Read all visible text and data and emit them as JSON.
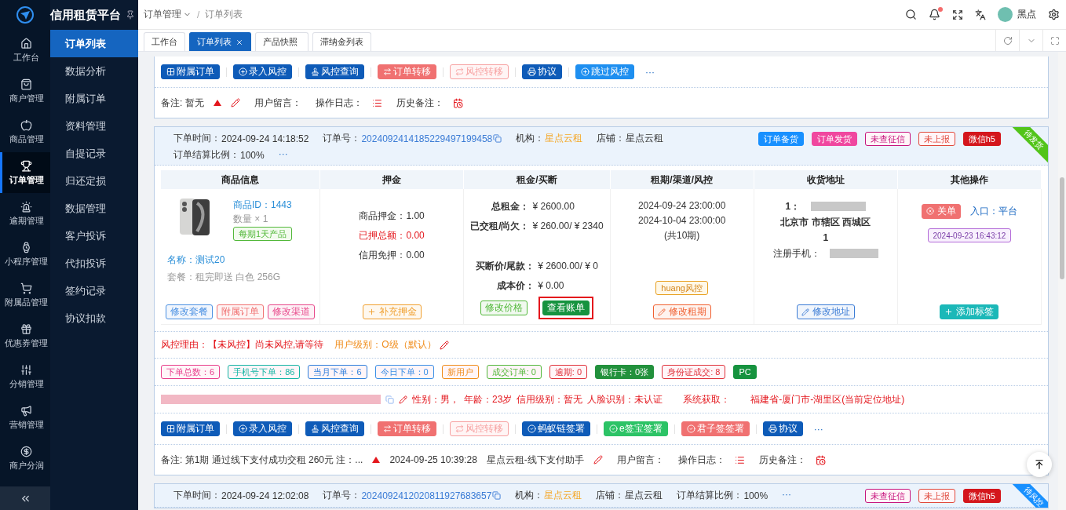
{
  "app": {
    "title": "信用租赁平台"
  },
  "rail": [
    {
      "label": "工作台",
      "selected": false
    },
    {
      "label": "商户管理",
      "selected": false
    },
    {
      "label": "商品管理",
      "selected": false
    },
    {
      "label": "订单管理",
      "selected": true
    },
    {
      "label": "逾期管理",
      "selected": false
    },
    {
      "label": "小程序管理",
      "selected": false
    },
    {
      "label": "附属品管理",
      "selected": false
    },
    {
      "label": "优惠券管理",
      "selected": false
    },
    {
      "label": "分销管理",
      "selected": false
    },
    {
      "label": "营销管理",
      "selected": false
    },
    {
      "label": "商户分润",
      "selected": false
    }
  ],
  "submenu": [
    {
      "label": "订单列表",
      "selected": true
    },
    {
      "label": "数据分析",
      "selected": false
    },
    {
      "label": "附属订单",
      "selected": false
    },
    {
      "label": "资料管理",
      "selected": false
    },
    {
      "label": "自提记录",
      "selected": false
    },
    {
      "label": "归还定损",
      "selected": false
    },
    {
      "label": "数据管理",
      "selected": false
    },
    {
      "label": "客户投诉",
      "selected": false
    },
    {
      "label": "代扣投诉",
      "selected": false
    },
    {
      "label": "签约记录",
      "selected": false
    },
    {
      "label": "协议扣款",
      "selected": false
    }
  ],
  "breadcrumb": {
    "items": [
      "订单管理",
      "订单列表"
    ],
    "separator": "/"
  },
  "header": {
    "user": "黑点",
    "unread": true
  },
  "tabs": [
    {
      "label": "工作台",
      "selected": false,
      "closable": false
    },
    {
      "label": "订单列表",
      "selected": true,
      "closable": true
    },
    {
      "label": "产品快照",
      "selected": false,
      "closable": false
    },
    {
      "label": "滞纳金列表",
      "selected": false,
      "closable": false
    }
  ],
  "orders": [
    {
      "actions": {
        "buttons": [
          {
            "label": "附属订单",
            "kind": "grid",
            "color": "#0e5bb8"
          },
          {
            "label": "录入风控",
            "kind": "plus",
            "color": "#0e5bb8"
          },
          {
            "label": "风控查询",
            "kind": "stamp",
            "color": "#0e5bb8"
          },
          {
            "label": "订单转移",
            "kind": "transfer",
            "color": "#f07171"
          },
          {
            "label": "风控转移",
            "kind": "repeat",
            "color": "#f7a1a1"
          },
          {
            "label": "协议",
            "kind": "print",
            "color": "#0e5bb8"
          },
          {
            "label": "跳过风控",
            "kind": "plus",
            "color": "#1e8ff0"
          }
        ],
        "more": "···"
      },
      "remark": {
        "text": "备注: 暂无",
        "labels": [
          "用户留言：",
          "操作日志：",
          "历史备注："
        ]
      }
    },
    {
      "header": {
        "fields": [
          {
            "label": "下单时间：",
            "value": "2024-09-24 14:18:52",
            "kind": "plain"
          },
          {
            "label": "订单号：",
            "value": "2024092414185229497199458",
            "kind": "link"
          },
          {
            "label": "机构：",
            "value": "星点云租",
            "kind": "accent"
          },
          {
            "label": "店铺：",
            "value": "星点云租",
            "kind": "plain"
          },
          {
            "label": "订单结算比例：",
            "value": "100%",
            "kind": "plain"
          }
        ],
        "more": "···",
        "tags": [
          {
            "label": "订单备货",
            "kind": "solid",
            "color": "#1890ff"
          },
          {
            "label": "订单发货",
            "kind": "solid",
            "color": "#f0479f"
          },
          {
            "label": "未查征信",
            "kind": "outline",
            "color": "#c7157e"
          },
          {
            "label": "未上报",
            "kind": "outline",
            "color": "#e0483c"
          },
          {
            "label": "微信h5",
            "kind": "solid",
            "color": "#d4161c"
          }
        ],
        "ribbon": {
          "label": "待发货",
          "color": "#52c41a"
        }
      },
      "table": {
        "columns": [
          "商品信息",
          "押金",
          "租金/买断",
          "租期/渠道/风控",
          "收货地址",
          "其他操作"
        ],
        "product": {
          "id": "商品ID：1443",
          "quantity": "数量 × 1",
          "tag": "每期1天产品",
          "name": "名称：测试20",
          "package": "套餐：租完即送 白色 256G",
          "buttons": [
            {
              "label": "修改套餐",
              "color": "#4a90e2"
            },
            {
              "label": "附属订单",
              "color": "#f07171"
            },
            {
              "label": "修改渠道",
              "color": "#e8488a"
            }
          ]
        },
        "deposit": {
          "lines": [
            {
              "label": "商品押金：",
              "value": "1.00",
              "alert": false
            },
            {
              "label": "已押总额：",
              "value": "0.00",
              "alert": true
            },
            {
              "label": "信用免押：",
              "value": "0.00",
              "alert": false
            }
          ],
          "button": "补充押金"
        },
        "rent": {
          "top": [
            {
              "label": "总租金：",
              "value": "¥ 2600.00"
            },
            {
              "label": "已交租/尚欠：",
              "value": "¥ 260.00/ ¥ 2340"
            }
          ],
          "bottom": [
            {
              "label": "买断价/尾款：",
              "value": "¥ 2600.00/ ¥ 0"
            },
            {
              "label": "成本价：",
              "value": "¥ 0.00"
            }
          ],
          "buttons": [
            {
              "label": "修改价格",
              "kind": "outline",
              "highlighted": false
            },
            {
              "label": "查看账单",
              "kind": "solid",
              "highlighted": true
            }
          ]
        },
        "term": {
          "start": "2024-09-24 23:00:00",
          "end": "2024-10-04 23:00:00",
          "periods": "(共10期)",
          "risk_tag": "huang风控",
          "button": "修改租期"
        },
        "address": {
          "name_label": "1：",
          "region": "北京市 市辖区 西城区",
          "detail": "1",
          "phone_label": "注册手机：",
          "button": "修改地址"
        },
        "other": {
          "close": "关单",
          "entry": "入口：平台",
          "time": "2024-09-23 16:43:12",
          "button": "添加标签"
        }
      },
      "risk": {
        "reason": "风控理由：【未风控】尚未风控,请等待",
        "level": "用户级别：O级（默认）"
      },
      "stats": [
        {
          "label": "下单总数：6",
          "kind": "outline",
          "color": "#e83e8c"
        },
        {
          "label": "手机号下单：86",
          "kind": "outline",
          "color": "#13b5a4"
        },
        {
          "label": "当月下单：6",
          "kind": "outline",
          "color": "#2f7fdc"
        },
        {
          "label": "今日下单：0",
          "kind": "outline",
          "color": "#3a8ee6"
        },
        {
          "label": "新用户",
          "kind": "outline",
          "color": "#f08c1a"
        },
        {
          "label": "成交订单: 0",
          "kind": "outline",
          "color": "#52b83a"
        },
        {
          "label": "逾期: 0",
          "kind": "outline",
          "color": "#e0323c"
        },
        {
          "label": "银行卡：0张",
          "kind": "solid",
          "color": "#22913c"
        },
        {
          "label": "身份证成交: 8",
          "kind": "outline",
          "color": "#e0323c"
        },
        {
          "label": "PC",
          "kind": "solid",
          "color": "#16933f"
        }
      ],
      "user_info": [
        "性别：男，",
        "年龄：23岁",
        "信用级别：暂无",
        "人脸识别：未认证",
        "系统获取：",
        "福建省-厦门市-湖里区(当前定位地址)"
      ],
      "actions": {
        "buttons": [
          {
            "label": "附属订单",
            "kind": "grid",
            "color": "#0e5bb8"
          },
          {
            "label": "录入风控",
            "kind": "plus",
            "color": "#0e5bb8"
          },
          {
            "label": "风控查询",
            "kind": "stamp",
            "color": "#0e5bb8"
          },
          {
            "label": "订单转移",
            "kind": "transfer",
            "color": "#f07171"
          },
          {
            "label": "风控转移",
            "kind": "repeat",
            "color": "#f7a1a1"
          },
          {
            "label": "蚂蚁链签署",
            "kind": "check",
            "color": "#0e5bb8"
          },
          {
            "label": "e签宝签署",
            "kind": "check",
            "color": "#2cc366"
          },
          {
            "label": "君子签签署",
            "kind": "check",
            "color": "#f07171"
          },
          {
            "label": "协议",
            "kind": "print",
            "color": "#0e5bb8"
          }
        ],
        "more": "···"
      },
      "remark": {
        "text": "备注: 第1期 通过线下支付成功交租 260元 注：...",
        "time": "2024-09-25 10:39:28",
        "author": "星点云租-线下支付助手",
        "labels": [
          "用户留言：",
          "操作日志：",
          "历史备注："
        ]
      }
    },
    {
      "header": {
        "fields": [
          {
            "label": "下单时间：",
            "value": "2024-09-24 12:02:08",
            "kind": "plain"
          },
          {
            "label": "订单号：",
            "value": "2024092412020811927683657",
            "kind": "link"
          },
          {
            "label": "机构：",
            "value": "星点云租",
            "kind": "accent"
          },
          {
            "label": "店铺：",
            "value": "星点云租",
            "kind": "plain"
          },
          {
            "label": "订单结算比例：",
            "value": "100%",
            "kind": "plain"
          }
        ],
        "more": "···",
        "tags": [
          {
            "label": "未查征信",
            "kind": "outline",
            "color": "#c7157e"
          },
          {
            "label": "未上报",
            "kind": "outline",
            "color": "#e0483c"
          },
          {
            "label": "微信h5",
            "kind": "solid",
            "color": "#d4161c"
          }
        ],
        "ribbon": {
          "label": "待风控",
          "color": "#1890ff"
        }
      }
    }
  ]
}
